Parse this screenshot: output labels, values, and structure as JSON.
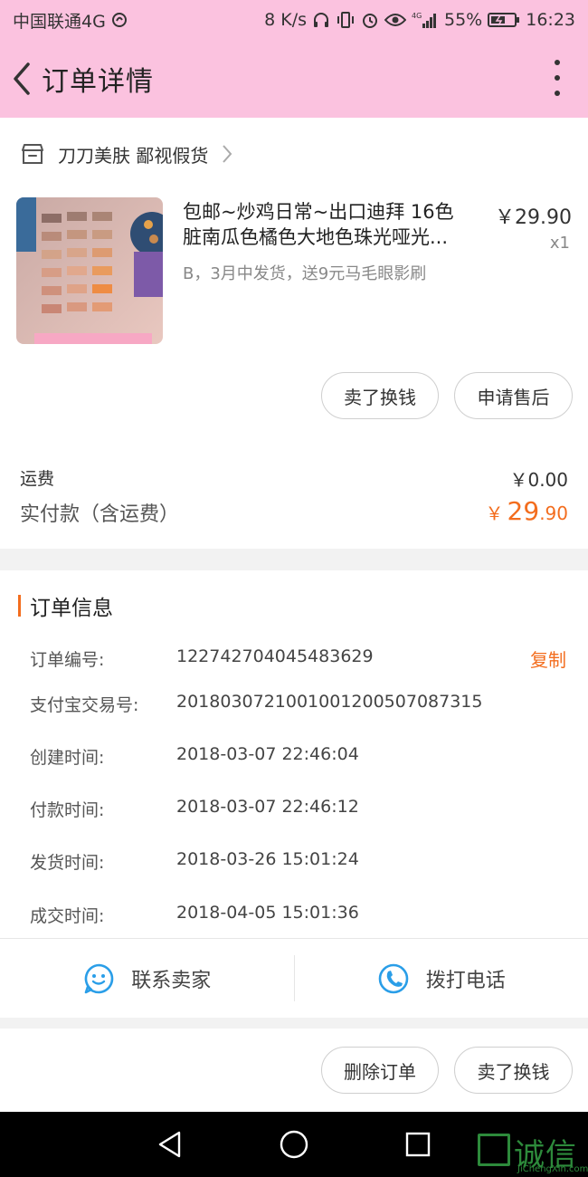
{
  "status_bar": {
    "carrier": "中国联通4G",
    "speed": "8 K/s",
    "network": "4G",
    "battery": "55%",
    "time": "16:23"
  },
  "header": {
    "title": "订单详情"
  },
  "shop": {
    "name": "刀刀美肤 鄙视假货"
  },
  "product": {
    "title_line1": "包邮~炒鸡日常~出口迪拜 16色",
    "title_line2": "脏南瓜色橘色大地色珠光哑光...",
    "spec": "B，3月中发货，送9元马毛眼影刷",
    "price": "￥29.90",
    "qty": "x1"
  },
  "product_actions": {
    "sell": "卖了换钱",
    "after_sale": "申请售后"
  },
  "fees": {
    "shipping_label": "运费",
    "shipping_value": "￥0.00",
    "paid_label": "实付款（含运费）",
    "paid_currency": "￥",
    "paid_int": "29",
    "paid_dec": ".90"
  },
  "order_info": {
    "title": "订单信息",
    "copy": "复制",
    "rows": [
      {
        "label": "订单编号:",
        "value": "122742704045483629"
      },
      {
        "label": "支付宝交易号:",
        "value": "2018030721001001200507087315"
      },
      {
        "label": "创建时间:",
        "value": "2018-03-07 22:46:04"
      },
      {
        "label": "付款时间:",
        "value": "2018-03-07 22:46:12"
      },
      {
        "label": "发货时间:",
        "value": "2018-03-26 15:01:24"
      },
      {
        "label": "成交时间:",
        "value": "2018-04-05 15:01:36"
      }
    ]
  },
  "contact": {
    "seller": "联系卖家",
    "call": "拨打电话"
  },
  "bottom_actions": {
    "delete": "删除订单",
    "sell": "卖了换钱"
  },
  "watermark": {
    "text": "诚信",
    "sub": "JiChengXin.com"
  },
  "colors": {
    "header_bg": "#fbc2df",
    "accent": "#f36d1e",
    "icon_blue": "#2a9ee8"
  }
}
